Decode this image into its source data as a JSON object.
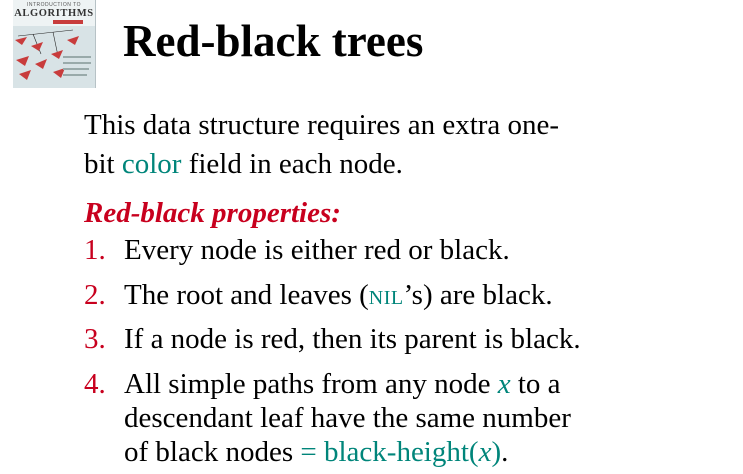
{
  "cover": {
    "small_text": "INTRODUCTION TO",
    "title": "ALGORITHMS"
  },
  "title": "Red-black trees",
  "intro": {
    "line1": "This data structure requires an extra one-",
    "line2_start": "bit ",
    "line2_highlight": "color",
    "line2_end": " field in each node."
  },
  "properties_heading": "Red-black properties:",
  "properties": [
    {
      "number": "1.",
      "text": "Every node is either red or black."
    },
    {
      "number": "2.",
      "text_start": "The root and leaves (",
      "nil": "NIL",
      "text_end": "’s) are black."
    },
    {
      "number": "3.",
      "text": "If a node is red, then its parent is black."
    },
    {
      "number": "4.",
      "line1_start": "All simple paths from any node ",
      "var_x": "x",
      "line1_end": " to a",
      "line2": "descendant leaf have the same number",
      "line3_start": "of black nodes ",
      "bh_eq": "= black-height(",
      "bh_x": "x",
      "bh_close": ")",
      "line3_end": "."
    }
  ],
  "colors": {
    "accent_red": "#c8001e",
    "accent_teal": "#00857a"
  }
}
